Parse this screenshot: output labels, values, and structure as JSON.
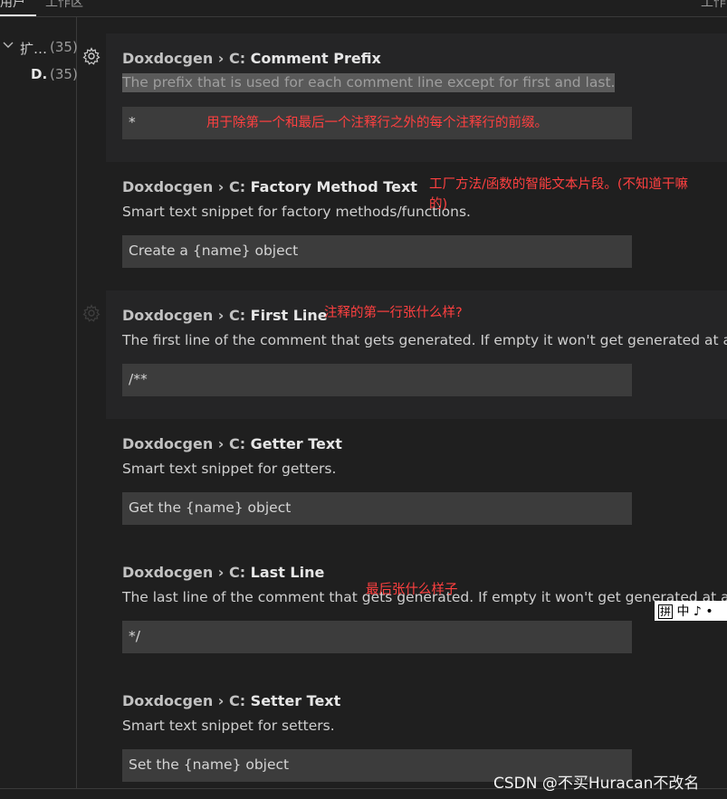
{
  "tabs": [
    {
      "label": "用户"
    },
    {
      "label": "工作区"
    },
    {
      "label": "工作"
    }
  ],
  "tree": [
    {
      "label": "扩…",
      "count": "(35)",
      "expanded": true,
      "icon": "chevron-down-icon"
    },
    {
      "label": "D.",
      "count": "(35)"
    }
  ],
  "settings": [
    {
      "prefix": "Doxdocgen › C: ",
      "name": "Comment Prefix",
      "description": "The prefix that is used for each comment line except for first and last.",
      "value": "*",
      "annotation": "用于除第一个和最后一个注释行之外的每个注释行的前缀。"
    },
    {
      "prefix": "Doxdocgen › C: ",
      "name": "Factory Method Text",
      "description": "Smart text snippet for factory methods/functions.",
      "value": "Create a {name} object",
      "annotation_line1": "工厂方法/函数的智能文本片段。(不知道干嘛",
      "annotation_line2": "的)"
    },
    {
      "prefix": "Doxdocgen › C: ",
      "name": "First Line",
      "description": "The first line of the comment that gets generated. If empty it won't get generated at all.",
      "value": "/**",
      "annotation": "注释的第一行张什么样?"
    },
    {
      "prefix": "Doxdocgen › C: ",
      "name": "Getter Text",
      "description": "Smart text snippet for getters.",
      "value": "Get the {name} object"
    },
    {
      "prefix": "Doxdocgen › C: ",
      "name": "Last Line",
      "description": "The last line of the comment that gets generated. If empty it won't get generated at all.",
      "value": "*/",
      "annotation": "最后张什么样子"
    },
    {
      "prefix": "Doxdocgen › C: ",
      "name": "Setter Text",
      "description": "Smart text snippet for setters.",
      "value": "Set the {name} object"
    }
  ],
  "ime": {
    "box": "拼",
    "mode": "中",
    "moon": "♪",
    "dot": "•"
  },
  "watermark": "CSDN @不买Huracan不改名",
  "colors": {
    "background": "#1f1f1f",
    "input": "#3c3c3c",
    "annotation": "#ff4040",
    "focused_row": "#252526"
  }
}
